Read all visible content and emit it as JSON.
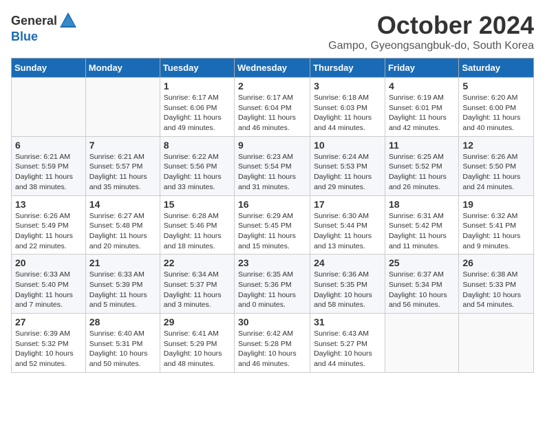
{
  "header": {
    "logo_general": "General",
    "logo_blue": "Blue",
    "title": "October 2024",
    "subtitle": "Gampo, Gyeongsangbuk-do, South Korea"
  },
  "weekdays": [
    "Sunday",
    "Monday",
    "Tuesday",
    "Wednesday",
    "Thursday",
    "Friday",
    "Saturday"
  ],
  "weeks": [
    [
      {
        "day": "",
        "sunrise": "",
        "sunset": "",
        "daylight": ""
      },
      {
        "day": "",
        "sunrise": "",
        "sunset": "",
        "daylight": ""
      },
      {
        "day": "1",
        "sunrise": "Sunrise: 6:17 AM",
        "sunset": "Sunset: 6:06 PM",
        "daylight": "Daylight: 11 hours and 49 minutes."
      },
      {
        "day": "2",
        "sunrise": "Sunrise: 6:17 AM",
        "sunset": "Sunset: 6:04 PM",
        "daylight": "Daylight: 11 hours and 46 minutes."
      },
      {
        "day": "3",
        "sunrise": "Sunrise: 6:18 AM",
        "sunset": "Sunset: 6:03 PM",
        "daylight": "Daylight: 11 hours and 44 minutes."
      },
      {
        "day": "4",
        "sunrise": "Sunrise: 6:19 AM",
        "sunset": "Sunset: 6:01 PM",
        "daylight": "Daylight: 11 hours and 42 minutes."
      },
      {
        "day": "5",
        "sunrise": "Sunrise: 6:20 AM",
        "sunset": "Sunset: 6:00 PM",
        "daylight": "Daylight: 11 hours and 40 minutes."
      }
    ],
    [
      {
        "day": "6",
        "sunrise": "Sunrise: 6:21 AM",
        "sunset": "Sunset: 5:59 PM",
        "daylight": "Daylight: 11 hours and 38 minutes."
      },
      {
        "day": "7",
        "sunrise": "Sunrise: 6:21 AM",
        "sunset": "Sunset: 5:57 PM",
        "daylight": "Daylight: 11 hours and 35 minutes."
      },
      {
        "day": "8",
        "sunrise": "Sunrise: 6:22 AM",
        "sunset": "Sunset: 5:56 PM",
        "daylight": "Daylight: 11 hours and 33 minutes."
      },
      {
        "day": "9",
        "sunrise": "Sunrise: 6:23 AM",
        "sunset": "Sunset: 5:54 PM",
        "daylight": "Daylight: 11 hours and 31 minutes."
      },
      {
        "day": "10",
        "sunrise": "Sunrise: 6:24 AM",
        "sunset": "Sunset: 5:53 PM",
        "daylight": "Daylight: 11 hours and 29 minutes."
      },
      {
        "day": "11",
        "sunrise": "Sunrise: 6:25 AM",
        "sunset": "Sunset: 5:52 PM",
        "daylight": "Daylight: 11 hours and 26 minutes."
      },
      {
        "day": "12",
        "sunrise": "Sunrise: 6:26 AM",
        "sunset": "Sunset: 5:50 PM",
        "daylight": "Daylight: 11 hours and 24 minutes."
      }
    ],
    [
      {
        "day": "13",
        "sunrise": "Sunrise: 6:26 AM",
        "sunset": "Sunset: 5:49 PM",
        "daylight": "Daylight: 11 hours and 22 minutes."
      },
      {
        "day": "14",
        "sunrise": "Sunrise: 6:27 AM",
        "sunset": "Sunset: 5:48 PM",
        "daylight": "Daylight: 11 hours and 20 minutes."
      },
      {
        "day": "15",
        "sunrise": "Sunrise: 6:28 AM",
        "sunset": "Sunset: 5:46 PM",
        "daylight": "Daylight: 11 hours and 18 minutes."
      },
      {
        "day": "16",
        "sunrise": "Sunrise: 6:29 AM",
        "sunset": "Sunset: 5:45 PM",
        "daylight": "Daylight: 11 hours and 15 minutes."
      },
      {
        "day": "17",
        "sunrise": "Sunrise: 6:30 AM",
        "sunset": "Sunset: 5:44 PM",
        "daylight": "Daylight: 11 hours and 13 minutes."
      },
      {
        "day": "18",
        "sunrise": "Sunrise: 6:31 AM",
        "sunset": "Sunset: 5:42 PM",
        "daylight": "Daylight: 11 hours and 11 minutes."
      },
      {
        "day": "19",
        "sunrise": "Sunrise: 6:32 AM",
        "sunset": "Sunset: 5:41 PM",
        "daylight": "Daylight: 11 hours and 9 minutes."
      }
    ],
    [
      {
        "day": "20",
        "sunrise": "Sunrise: 6:33 AM",
        "sunset": "Sunset: 5:40 PM",
        "daylight": "Daylight: 11 hours and 7 minutes."
      },
      {
        "day": "21",
        "sunrise": "Sunrise: 6:33 AM",
        "sunset": "Sunset: 5:39 PM",
        "daylight": "Daylight: 11 hours and 5 minutes."
      },
      {
        "day": "22",
        "sunrise": "Sunrise: 6:34 AM",
        "sunset": "Sunset: 5:37 PM",
        "daylight": "Daylight: 11 hours and 3 minutes."
      },
      {
        "day": "23",
        "sunrise": "Sunrise: 6:35 AM",
        "sunset": "Sunset: 5:36 PM",
        "daylight": "Daylight: 11 hours and 0 minutes."
      },
      {
        "day": "24",
        "sunrise": "Sunrise: 6:36 AM",
        "sunset": "Sunset: 5:35 PM",
        "daylight": "Daylight: 10 hours and 58 minutes."
      },
      {
        "day": "25",
        "sunrise": "Sunrise: 6:37 AM",
        "sunset": "Sunset: 5:34 PM",
        "daylight": "Daylight: 10 hours and 56 minutes."
      },
      {
        "day": "26",
        "sunrise": "Sunrise: 6:38 AM",
        "sunset": "Sunset: 5:33 PM",
        "daylight": "Daylight: 10 hours and 54 minutes."
      }
    ],
    [
      {
        "day": "27",
        "sunrise": "Sunrise: 6:39 AM",
        "sunset": "Sunset: 5:32 PM",
        "daylight": "Daylight: 10 hours and 52 minutes."
      },
      {
        "day": "28",
        "sunrise": "Sunrise: 6:40 AM",
        "sunset": "Sunset: 5:31 PM",
        "daylight": "Daylight: 10 hours and 50 minutes."
      },
      {
        "day": "29",
        "sunrise": "Sunrise: 6:41 AM",
        "sunset": "Sunset: 5:29 PM",
        "daylight": "Daylight: 10 hours and 48 minutes."
      },
      {
        "day": "30",
        "sunrise": "Sunrise: 6:42 AM",
        "sunset": "Sunset: 5:28 PM",
        "daylight": "Daylight: 10 hours and 46 minutes."
      },
      {
        "day": "31",
        "sunrise": "Sunrise: 6:43 AM",
        "sunset": "Sunset: 5:27 PM",
        "daylight": "Daylight: 10 hours and 44 minutes."
      },
      {
        "day": "",
        "sunrise": "",
        "sunset": "",
        "daylight": ""
      },
      {
        "day": "",
        "sunrise": "",
        "sunset": "",
        "daylight": ""
      }
    ]
  ]
}
